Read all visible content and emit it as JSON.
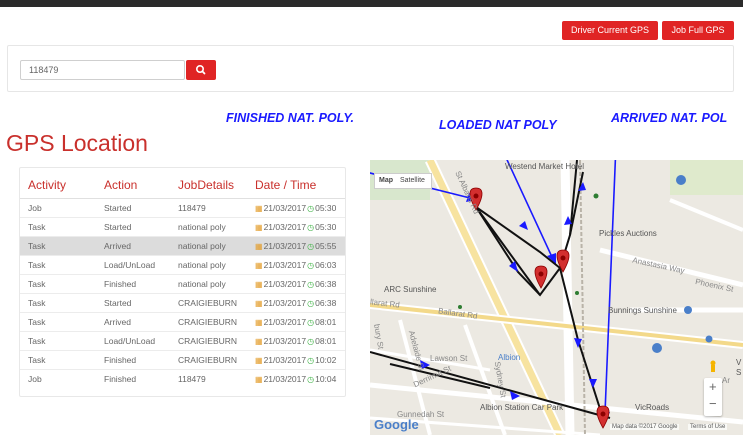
{
  "header": {
    "driver_gps_label": "Driver Current GPS",
    "job_gps_label": "Job Full GPS"
  },
  "search": {
    "value": "118479",
    "button_icon": "search-icon"
  },
  "page_title": "GPS Location",
  "annotations": {
    "finished": "FINISHED NAT. POLY.",
    "loaded": "LOADED NAT POLY",
    "arrived": "ARRIVED NAT. POL"
  },
  "table": {
    "headers": [
      "Activity",
      "Action",
      "JobDetails",
      "Date / Time"
    ],
    "rows": [
      {
        "activity": "Job",
        "action": "Started",
        "details": "118479",
        "date": "21/03/2017",
        "time": "05:30"
      },
      {
        "activity": "Task",
        "action": "Started",
        "details": "national poly",
        "date": "21/03/2017",
        "time": "05:30"
      },
      {
        "activity": "Task",
        "action": "Arrived",
        "details": "national poly",
        "date": "21/03/2017",
        "time": "05:55"
      },
      {
        "activity": "Task",
        "action": "Load/UnLoad",
        "details": "national poly",
        "date": "21/03/2017",
        "time": "06:03"
      },
      {
        "activity": "Task",
        "action": "Finished",
        "details": "national poly",
        "date": "21/03/2017",
        "time": "06:38"
      },
      {
        "activity": "Task",
        "action": "Started",
        "details": "CRAIGIEBURN",
        "date": "21/03/2017",
        "time": "06:38"
      },
      {
        "activity": "Task",
        "action": "Arrived",
        "details": "CRAIGIEBURN",
        "date": "21/03/2017",
        "time": "08:01"
      },
      {
        "activity": "Task",
        "action": "Load/UnLoad",
        "details": "CRAIGIEBURN",
        "date": "21/03/2017",
        "time": "08:01"
      },
      {
        "activity": "Task",
        "action": "Finished",
        "details": "CRAIGIEBURN",
        "date": "21/03/2017",
        "time": "10:02"
      },
      {
        "activity": "Job",
        "action": "Finished",
        "details": "118479",
        "date": "21/03/2017",
        "time": "10:04"
      }
    ]
  },
  "map": {
    "map_tab": "Map",
    "satellite_tab": "Satellite",
    "labels": {
      "westend": "Westend Market Hotel",
      "pickles": "Pickles Auctions",
      "anastasia": "Anastasia Way",
      "phoenix": "Phoenix St",
      "bunnings": "Bunnings Sunshine",
      "arc": "ARC Sunshine",
      "ballarat": "Ballarat Rd",
      "ballarat_left": "llarat Rd",
      "st_albans": "St Albans Rd",
      "adelaide": "Adelaide St",
      "lawson": "Lawson St",
      "albion": "Albion",
      "derrimut": "Derrimut St",
      "gunnedah": "Gunnedah St",
      "albion_station": "Albion Station Car Park",
      "vicroads": "VicRoads",
      "sydney": "Sydney St",
      "burry": "bury St",
      "v_st": "V",
      "s_st": "S",
      "google": "Google",
      "map_data": "Map data ©2017 Google",
      "terms": "Terms of Use",
      "ar_st": "Ar"
    },
    "marker_color": "#d32f2f",
    "route_color": "#111111",
    "arrow_color": "#1a1aff"
  }
}
